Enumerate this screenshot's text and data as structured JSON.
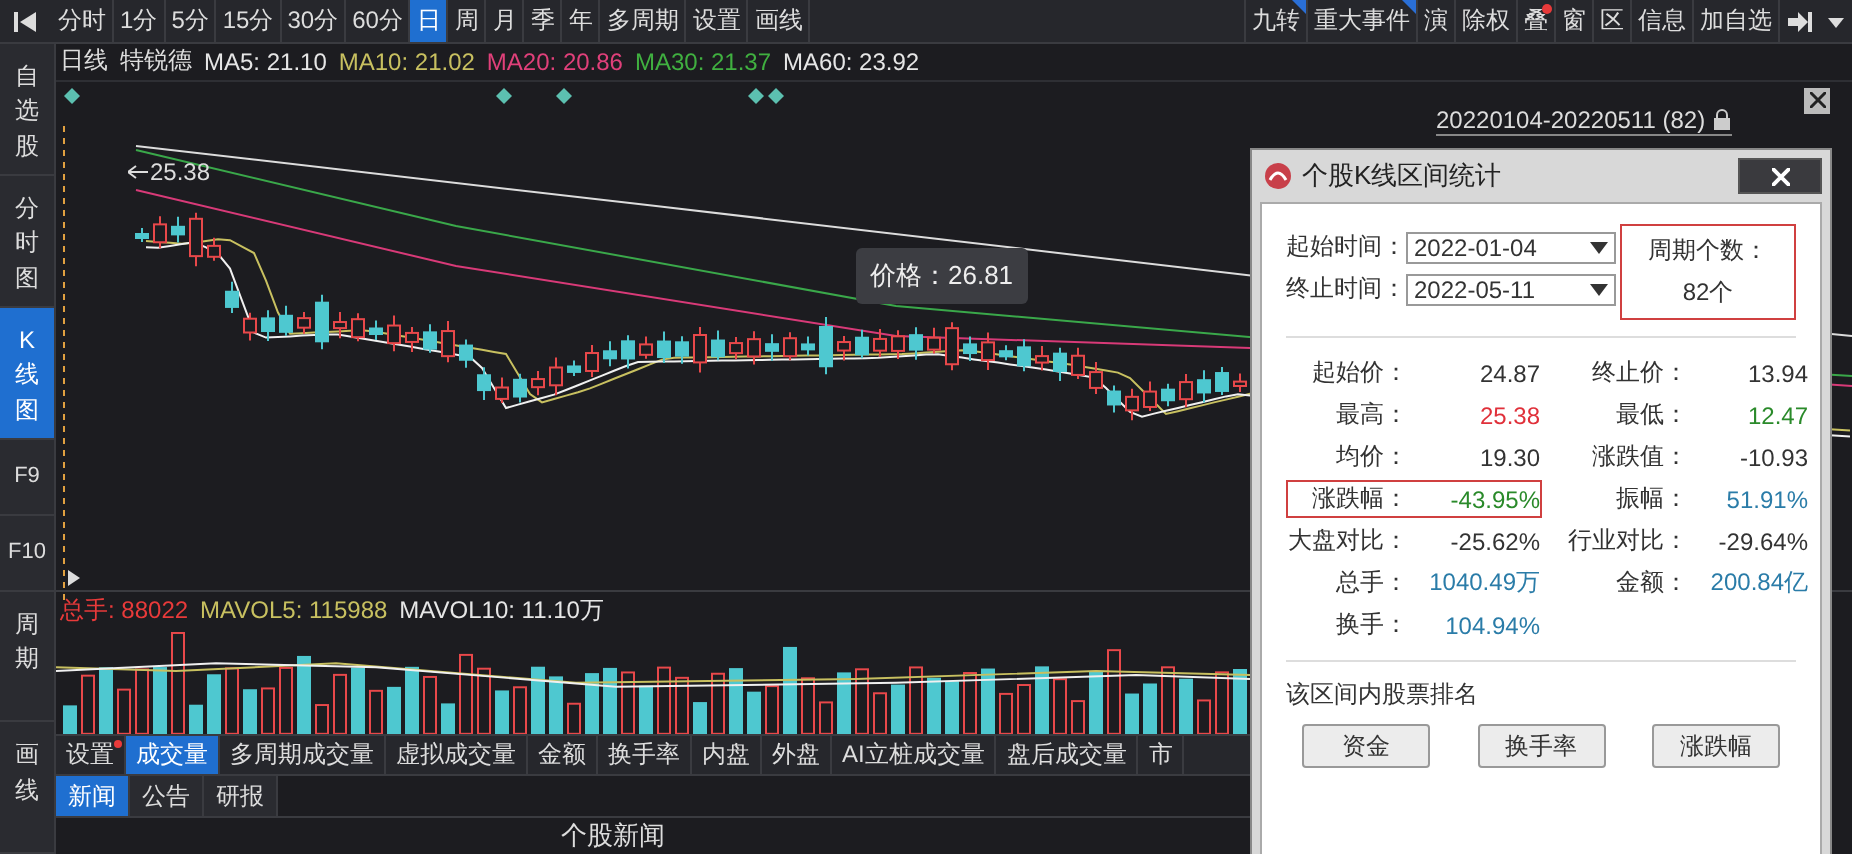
{
  "toolbar": {
    "period_tabs": [
      {
        "label": "分时",
        "selected": false
      },
      {
        "label": "1分",
        "selected": false
      },
      {
        "label": "5分",
        "selected": false
      },
      {
        "label": "15分",
        "selected": false
      },
      {
        "label": "30分",
        "selected": false
      },
      {
        "label": "60分",
        "selected": false
      },
      {
        "label": "日",
        "selected": true
      },
      {
        "label": "周",
        "selected": false
      },
      {
        "label": "月",
        "selected": false
      },
      {
        "label": "季",
        "selected": false
      },
      {
        "label": "年",
        "selected": false
      },
      {
        "label": "多周期",
        "selected": false
      },
      {
        "label": "设置",
        "selected": false
      },
      {
        "label": "画线",
        "selected": false
      }
    ],
    "right_items": [
      {
        "label": "九转",
        "corner_flag": true,
        "dot": false
      },
      {
        "label": "重大事件",
        "corner_flag": true,
        "dot": false
      },
      {
        "label": "演",
        "corner_flag": false,
        "dot": false
      },
      {
        "label": "除权",
        "corner_flag": false,
        "dot": false
      },
      {
        "label": "叠",
        "corner_flag": false,
        "dot": true
      },
      {
        "label": "窗",
        "corner_flag": false,
        "dot": false
      },
      {
        "label": "区",
        "corner_flag": false,
        "dot": false
      },
      {
        "label": "信息",
        "corner_flag": false,
        "dot": false
      },
      {
        "label": "加自选",
        "corner_flag": false,
        "dot": false
      }
    ]
  },
  "sidebar": {
    "items": [
      {
        "label": "自选股",
        "kind": "stack",
        "selected": false
      },
      {
        "label": "分时图",
        "kind": "stack",
        "selected": false
      },
      {
        "label": "K线图",
        "kind": "stack",
        "selected": true
      },
      {
        "label": "F9",
        "kind": "inline",
        "selected": false
      },
      {
        "label": "F10",
        "kind": "inline",
        "selected": false
      },
      {
        "label": "周期",
        "kind": "stack",
        "selected": false
      },
      {
        "label": "画线",
        "kind": "stack",
        "selected": false
      }
    ]
  },
  "chart_header": {
    "period": "日线",
    "stock": "特锐德",
    "ma": [
      {
        "text": "MA5: 21.10",
        "color": "#e6e6e6"
      },
      {
        "text": "MA10: 21.02",
        "color": "#c8c060"
      },
      {
        "text": "MA20: 20.86",
        "color": "#e0407a"
      },
      {
        "text": "MA30: 21.37",
        "color": "#40b040"
      },
      {
        "text": "MA60: 23.92",
        "color": "#e6e6e6"
      }
    ]
  },
  "range_label": "20220104-20220511 (82)",
  "high_label": "25.38",
  "tooltip": "价格：26.81",
  "volume_header": [
    {
      "text": "总手: 88022",
      "color": "#e83a3a"
    },
    {
      "text": "MAVOL5: 115988",
      "color": "#c8c060"
    },
    {
      "text": "MAVOL10: 11.10万",
      "color": "#e6e6e6"
    }
  ],
  "indicator_tabs": [
    {
      "label": "设置",
      "selected": false,
      "flagged": true
    },
    {
      "label": "成交量",
      "selected": true,
      "flagged": false
    },
    {
      "label": "多周期成交量",
      "selected": false,
      "flagged": false
    },
    {
      "label": "虚拟成交量",
      "selected": false,
      "flagged": false
    },
    {
      "label": "金额",
      "selected": false,
      "flagged": false
    },
    {
      "label": "换手率",
      "selected": false,
      "flagged": false
    },
    {
      "label": "内盘",
      "selected": false,
      "flagged": false
    },
    {
      "label": "外盘",
      "selected": false,
      "flagged": false
    },
    {
      "label": "AI立桩成交量",
      "selected": false,
      "flagged": false
    },
    {
      "label": "盘后成交量",
      "selected": false,
      "flagged": false
    },
    {
      "label": "市",
      "selected": false,
      "flagged": false
    }
  ],
  "news_tabs": [
    {
      "label": "新闻",
      "selected": true
    },
    {
      "label": "公告",
      "selected": false
    },
    {
      "label": "研报",
      "selected": false
    }
  ],
  "news_panel": {
    "title": "个股新闻"
  },
  "dialog": {
    "title": "个股K线区间统计",
    "start_label": "起始时间：",
    "start_value": "2022-01-04",
    "end_label": "终止时间：",
    "end_value": "2022-05-11",
    "count_label": "周期个数：",
    "count_value": "82个",
    "stats": [
      {
        "label": "起始价：",
        "value": "24.87",
        "color": "#333333",
        "boxed": false
      },
      {
        "label": "终止价：",
        "value": "13.94",
        "color": "#333333",
        "boxed": false
      },
      {
        "label": "最高：",
        "value": "25.38",
        "color": "#e0303a",
        "boxed": false
      },
      {
        "label": "最低：",
        "value": "12.47",
        "color": "#2a8a2a",
        "boxed": false
      },
      {
        "label": "均价：",
        "value": "19.30",
        "color": "#333333",
        "boxed": false
      },
      {
        "label": "涨跌值：",
        "value": "-10.93",
        "color": "#333333",
        "boxed": false
      },
      {
        "label": "涨跌幅：",
        "value": "-43.95%",
        "color": "#2a8a2a",
        "boxed": true
      },
      {
        "label": "振幅：",
        "value": "51.91%",
        "color": "#2a7ca8",
        "boxed": false
      },
      {
        "label": "大盘对比：",
        "value": "-25.62%",
        "color": "#333333",
        "boxed": false
      },
      {
        "label": "行业对比：",
        "value": "-29.64%",
        "color": "#333333",
        "boxed": false
      },
      {
        "label": "总手：",
        "value": "1040.49万",
        "color": "#2a7ca8",
        "boxed": false
      },
      {
        "label": "金额：",
        "value": "200.84亿",
        "color": "#2a7ca8",
        "boxed": false
      },
      {
        "label": "换手：",
        "value": "104.94%",
        "color": "#2a7ca8",
        "boxed": false
      }
    ],
    "ranking_title": "该区间内股票排名",
    "buttons": [
      "资金",
      "换手率",
      "涨跌幅"
    ]
  }
}
